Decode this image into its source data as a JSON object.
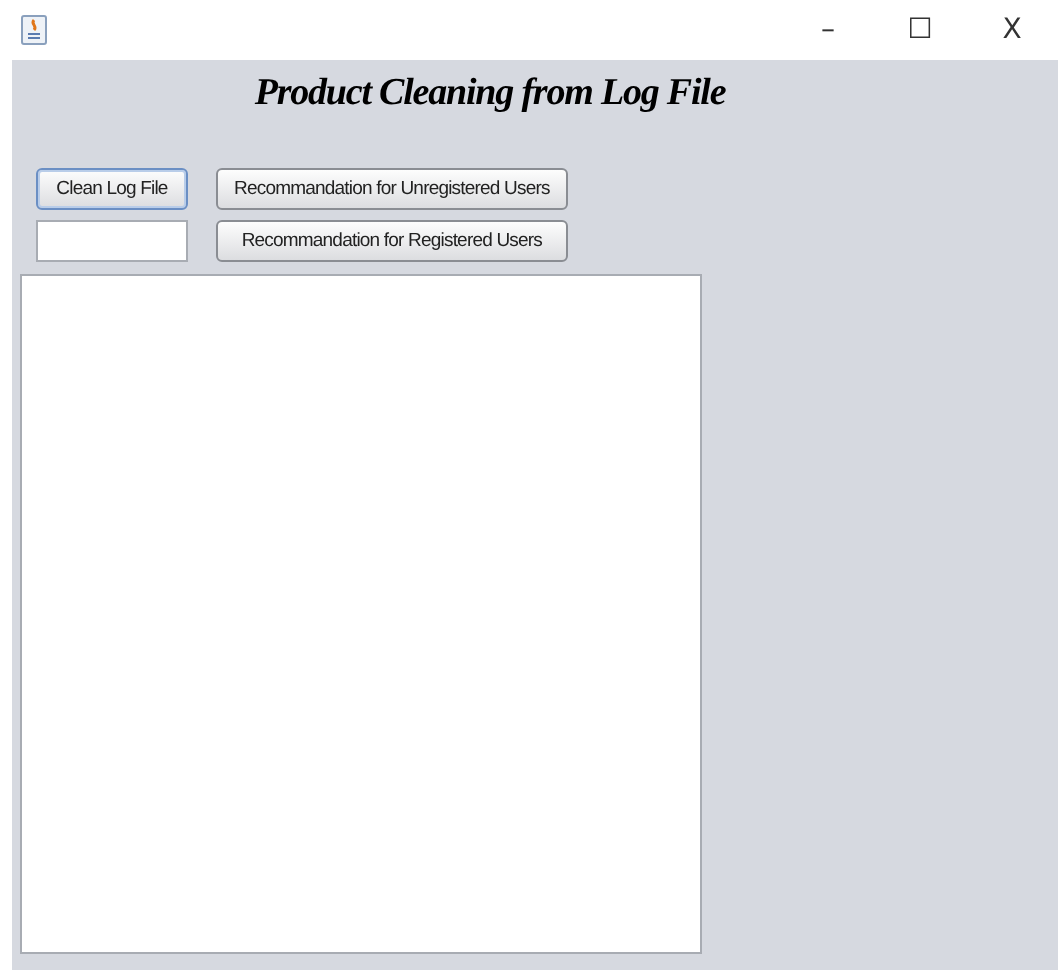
{
  "window": {
    "controls": [
      "–",
      "☐",
      "X"
    ]
  },
  "heading": "Product Cleaning from Log File",
  "buttons": [
    {
      "label": "Clean Log File",
      "focused": true
    },
    {
      "label": "Recommandation for Unregistered Users",
      "focused": false
    },
    {
      "label": "Recommandation for Registered Users",
      "focused": false
    }
  ]
}
